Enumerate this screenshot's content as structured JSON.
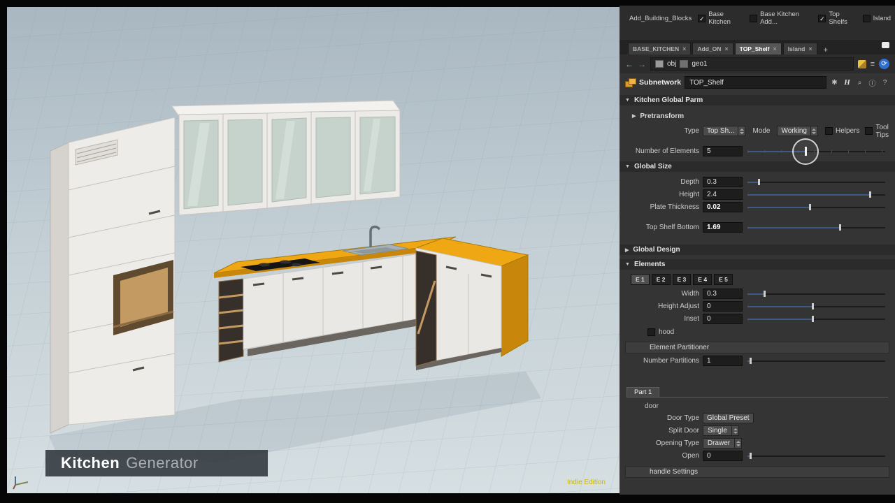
{
  "viewport": {
    "title_primary": "Kitchen",
    "title_secondary": "Generator",
    "watermark": "Indie Edition"
  },
  "panel": {
    "toggles_bar": {
      "group_label": "Add_Building_Blocks",
      "items": [
        {
          "label": "Base Kitchen",
          "check": "✓"
        },
        {
          "label": "Base Kitchen Add...",
          "check": ""
        },
        {
          "label": "Top Shelfs",
          "check": "✓"
        },
        {
          "label": "Island",
          "check": ""
        }
      ]
    },
    "tab_bar": {
      "tabs": [
        {
          "label": "BASE_KITCHEN",
          "close": "×"
        },
        {
          "label": "Add_ON",
          "close": "×"
        },
        {
          "label": "TOP_Shelf",
          "close": "×"
        },
        {
          "label": "Island",
          "close": "×"
        }
      ],
      "add_tab": "+"
    },
    "nav": {
      "back": "←",
      "forward": "→",
      "root": "obj",
      "node": "geo1",
      "recook": "⟳"
    },
    "subnetwork": {
      "type_label": "Subnetwork",
      "name": "TOP_Shelf",
      "icons": {
        "gear": "✱",
        "houdini": "H",
        "search": "⌕",
        "info": "ⓘ",
        "help": "?"
      }
    },
    "sections": {
      "kitchen_global_parm": {
        "arrow": "▼",
        "label": "Kitchen Global Parm"
      },
      "pretransform": {
        "arrow": "▶",
        "label": "Pretransform"
      },
      "global_size": {
        "arrow": "▼",
        "label": "Global Size"
      },
      "global_design": {
        "arrow": "▶",
        "label": "Global Design"
      },
      "elements": {
        "arrow": "▼",
        "label": "Elements"
      }
    },
    "type_row": {
      "type_label": "Type",
      "type_value": "Top Sh...",
      "mode_label": "Mode",
      "mode_value": "Working",
      "helpers": {
        "label": "Helpers",
        "check": ""
      },
      "tool_tips": {
        "label": "Tool Tips",
        "check": ""
      }
    },
    "params": {
      "number_of_elements": {
        "label": "Number of Elements",
        "value": "5",
        "slider": 0.42
      },
      "depth": {
        "label": "Depth",
        "value": "0.3",
        "slider": 0.08
      },
      "height": {
        "label": "Height",
        "value": "2.4",
        "slider": 0.89
      },
      "plate_thickness": {
        "label": "Plate Thickness",
        "value": "0.02",
        "slider": 0.45
      },
      "top_shelf_bottom": {
        "label": "Top Shelf Bottom",
        "value": "1.69",
        "slider": 0.67
      },
      "width": {
        "label": "Width",
        "value": "0.3",
        "slider": 0.12
      },
      "height_adjust": {
        "label": "Height Adjust",
        "value": "0",
        "slider": 0.47
      },
      "inset": {
        "label": "Inset",
        "value": "0",
        "slider": 0.47
      },
      "number_partitions": {
        "label": "Number Partitions",
        "value": "1",
        "slider": 0.02
      },
      "open": {
        "label": "Open",
        "value": "0",
        "slider": 0.02
      }
    },
    "elements_tabs": [
      {
        "label": "E 1"
      },
      {
        "label": "E 2"
      },
      {
        "label": "E 3"
      },
      {
        "label": "E 4"
      },
      {
        "label": "E 5"
      }
    ],
    "hood": {
      "label": "hood",
      "check": ""
    },
    "element_partitioner": {
      "label": "Element Partitioner"
    },
    "part_tab": {
      "label": "Part 1"
    },
    "door_group": {
      "label": "door"
    },
    "door_type": {
      "label": "Door Type",
      "value": "Global Preset"
    },
    "split_door": {
      "label": "Split Door",
      "value": "Single"
    },
    "opening_type": {
      "label": "Opening Type",
      "value": "Drawer"
    },
    "handle_settings": {
      "label": "handle Settings"
    }
  }
}
